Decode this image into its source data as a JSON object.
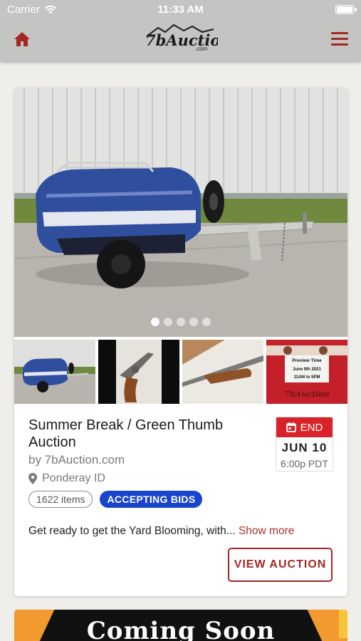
{
  "status_bar": {
    "carrier": "Carrier",
    "time": "11:33 AM"
  },
  "nav": {
    "logo_text": "7bAuction",
    "logo_sub": ".com",
    "icons": [
      "home-icon",
      "hamburger-menu-icon"
    ],
    "accent_color": "#a32822"
  },
  "auction": {
    "title": "Summer Break / Green Thumb Auction",
    "byline": "by 7bAuction.com",
    "location": "Ponderay ID",
    "items_count": "1622 items",
    "status": "ACCEPTING BIDS",
    "end_label": "END",
    "end_date": "JUN 10",
    "end_time": "6:00p PDT",
    "description": "Get ready to get the Yard Blooming, with...",
    "show_more": "Show more",
    "view_button": "VIEW AUCTION",
    "carousel_dots": 5,
    "active_dot": 0,
    "thumbnail_4": {
      "line1": "Preview Time",
      "line2": "June 9th 2021",
      "line3": "11AM to 5PM",
      "logo": "7bAuction"
    }
  },
  "next_card": {
    "text": "Coming Soon"
  }
}
